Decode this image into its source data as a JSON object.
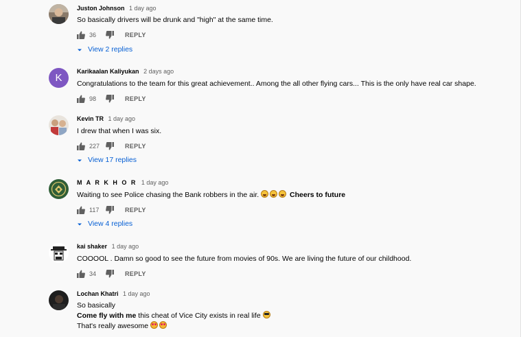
{
  "comments": [
    {
      "author": "Juston Johnson",
      "time": "1 day ago",
      "text": "So basically drivers will be drunk and \"high\" at the same time.",
      "likes": "36",
      "reply": "REPLY",
      "view_replies": "View 2 replies",
      "avatar_icon": "user-photo-avatar"
    },
    {
      "author": "Karikaalan Kaliyukan",
      "time": "2 days ago",
      "text": "Congratulations to the team for this great achievement.. Among the all other flying cars... This is the only have real car shape.",
      "likes": "98",
      "reply": "REPLY",
      "avatar_letter": "K",
      "avatar_color": "#7e57c2"
    },
    {
      "author": "Kevin TR",
      "time": "1 day ago",
      "text": "I drew that when I was six.",
      "likes": "227",
      "reply": "REPLY",
      "view_replies": "View 17 replies",
      "avatar_icon": "user-photo-avatar"
    },
    {
      "author": "M A R K H O R",
      "time": "1 day ago",
      "text_plain": "Waiting to see Police chasing the Bank robbers in the air.",
      "text_bold": "Cheers to future",
      "emojis": [
        "laughing-emoji",
        "laughing-emoji",
        "laughing-emoji"
      ],
      "likes": "117",
      "reply": "REPLY",
      "view_replies": "View 4 replies",
      "avatar_icon": "emblem-avatar"
    },
    {
      "author": "kai shaker",
      "time": "1 day ago",
      "text": "COOOOL . Damn so good to see the future from movies of 90s. We are living the future of our childhood.",
      "likes": "34",
      "reply": "REPLY",
      "avatar_icon": "cartoon-face-avatar"
    },
    {
      "author": "Lochan Khatri",
      "time": "1 day ago",
      "line1": "So basically",
      "line2_bold": "Come fly with me",
      "line2_plain": " this cheat of Vice City exists in real life",
      "line3": "That's really awesome",
      "emojis": [
        "sunglasses-emoji",
        "heart-eyes-emoji",
        "heart-eyes-emoji"
      ],
      "avatar_icon": "dark-photo-avatar"
    }
  ],
  "colors": {
    "link_blue": "#065fd4",
    "secondary_text": "#606060",
    "background": "#f9f9f9"
  }
}
